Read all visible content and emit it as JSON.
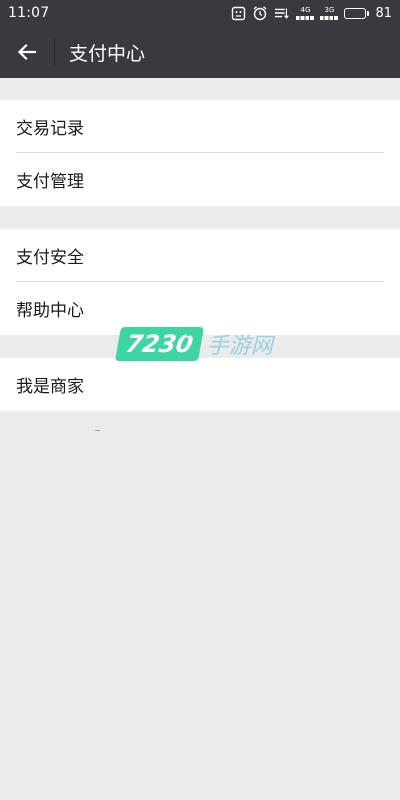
{
  "status_bar": {
    "time": "11:07",
    "network_1": "4G",
    "network_2": "3G",
    "battery_level": "81",
    "battery_fraction": 0.81,
    "icons": [
      "screenshot-icon",
      "alarm-icon",
      "data-transfer-icon",
      "signal-icon",
      "battery-icon"
    ]
  },
  "header": {
    "title": "支付中心",
    "back_icon": "arrow-left-icon"
  },
  "groups": [
    {
      "items": [
        {
          "label": "交易记录"
        },
        {
          "label": "支付管理"
        }
      ]
    },
    {
      "items": [
        {
          "label": "支付安全"
        },
        {
          "label": "帮助中心"
        }
      ]
    },
    {
      "items": [
        {
          "label": "我是商家"
        }
      ]
    }
  ],
  "watermark": {
    "number": "7230",
    "text": "手游网",
    "accent_color": "#3dd6a3"
  },
  "colors": {
    "bar_background": "#393a3f",
    "page_background": "#ebebeb",
    "row_background": "#ffffff"
  }
}
